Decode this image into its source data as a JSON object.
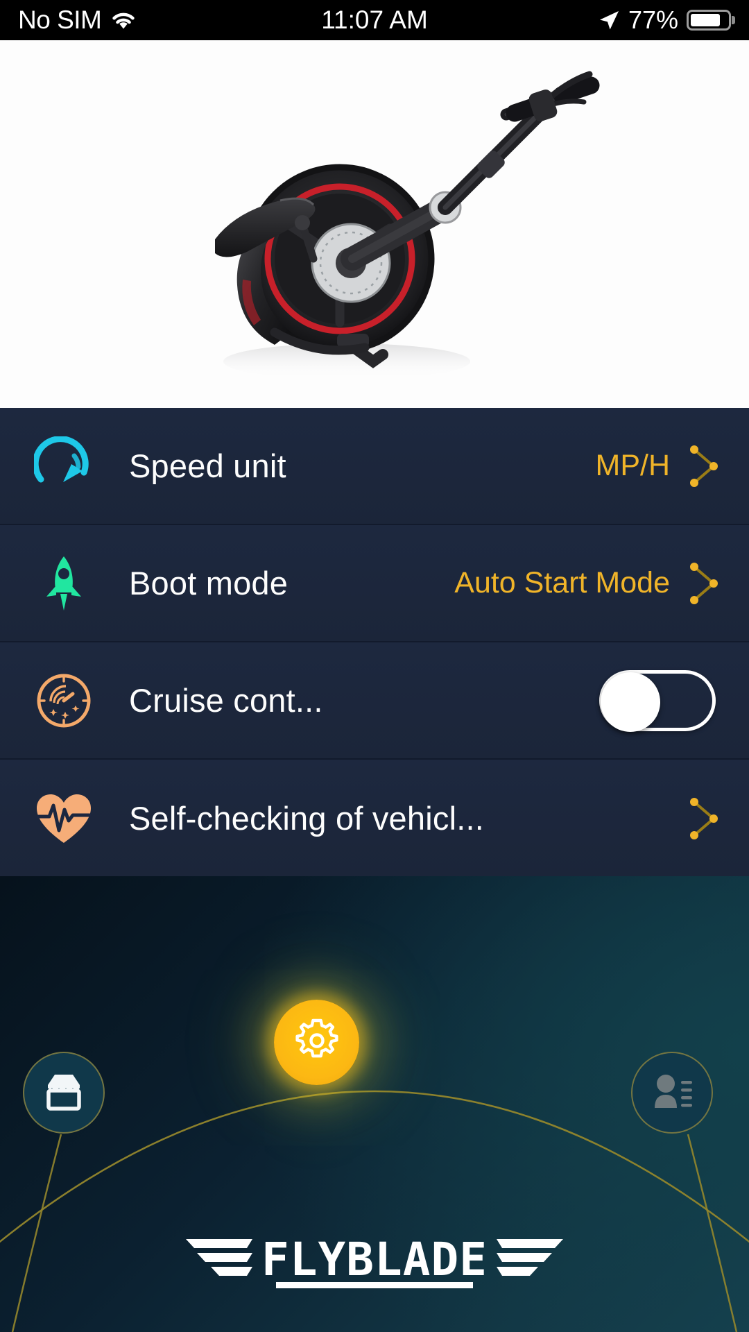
{
  "status_bar": {
    "carrier": "No SIM",
    "wifi_icon": "wifi-icon",
    "time": "11:07 AM",
    "location_icon": "location-arrow-icon",
    "battery_percent": "77%",
    "battery_level": 80,
    "battery_icon": "battery-icon"
  },
  "hero": {
    "product_image_alt": "folded-electric-scooter",
    "background": "#fdfdfd",
    "frame_color": "#2a2a2c",
    "rim_accent_color": "#c8202a"
  },
  "settings": {
    "panel_background": "#1c2740",
    "rows": [
      {
        "icon": "speedometer-icon",
        "icon_color": "#1ec8e8",
        "label": "Speed unit",
        "value": "MP/H",
        "control": "chevron",
        "chevron_icon": "chevron-right-dotted-icon"
      },
      {
        "icon": "rocket-icon",
        "icon_color": "#21e6a0",
        "label": "Boot mode",
        "value": "Auto Start Mode",
        "control": "chevron",
        "chevron_icon": "chevron-right-dotted-icon"
      },
      {
        "icon": "cruise-gauge-icon",
        "icon_color": "#f4a96a",
        "label": "Cruise cont...",
        "value": "",
        "control": "toggle",
        "toggle_on": false
      },
      {
        "icon": "heart-pulse-icon",
        "icon_color": "#f6ad78",
        "label": "Self-checking of vehicl...",
        "value": "",
        "control": "chevron",
        "chevron_icon": "chevron-right-dotted-icon"
      }
    ]
  },
  "bottom_nav": {
    "arc_color": "#9a8c2e",
    "items": [
      {
        "name": "shop",
        "icon": "shop-storefront-icon",
        "icon_color": "#f2f6f8",
        "position": "left"
      },
      {
        "name": "settings",
        "icon": "gear-icon",
        "icon_color": "#ffffff",
        "position": "center",
        "active": true
      },
      {
        "name": "profile",
        "icon": "user-contact-icon",
        "icon_color": "#6f7a7e",
        "position": "right"
      }
    ]
  },
  "branding": {
    "logo_text": "FLYBLADE",
    "logo_color": "#ffffff"
  },
  "theme": {
    "accent_amber": "#f0b429",
    "panel_navy": "#1c2740",
    "divider": "#121a2c",
    "status_bar_bg": "#000000"
  }
}
